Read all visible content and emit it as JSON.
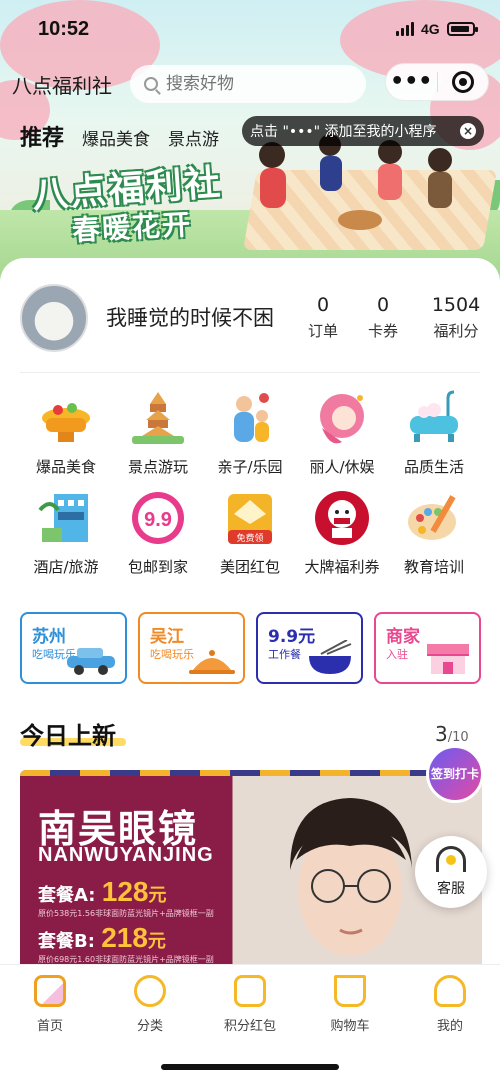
{
  "status_bar": {
    "time": "10:52",
    "network": "4G"
  },
  "nav": {
    "title": "八点福利社",
    "search_placeholder": "搜索好物",
    "more_label": "•••"
  },
  "tabs": [
    {
      "label": "推荐",
      "active": true
    },
    {
      "label": "爆品美食"
    },
    {
      "label": "景点游"
    }
  ],
  "tip": {
    "text": "点击 \"•••\" 添加至我的小程序",
    "close": "×"
  },
  "banner": {
    "title": "八点福利社",
    "subtitle": "春暖花开"
  },
  "profile": {
    "username": "我睡觉的时候不困",
    "stats": [
      {
        "value": "0",
        "label": "订单"
      },
      {
        "value": "0",
        "label": "卡券"
      },
      {
        "value": "1504",
        "label": "福利分"
      }
    ]
  },
  "categories": [
    {
      "label": "爆品美食",
      "icon": "hotpot-icon",
      "color": "#f6b627"
    },
    {
      "label": "景点游玩",
      "icon": "pagoda-icon",
      "color": "#e6a34a"
    },
    {
      "label": "亲子/乐园",
      "icon": "family-icon",
      "color": "#5aa9e6"
    },
    {
      "label": "丽人/休娱",
      "icon": "beauty-icon",
      "color": "#f07aa0"
    },
    {
      "label": "品质生活",
      "icon": "bathtub-icon",
      "color": "#4cc2e0"
    },
    {
      "label": "酒店/旅游",
      "icon": "hotel-icon",
      "color": "#52b5e8"
    },
    {
      "label": "包邮到家",
      "icon": "nine-nine-icon",
      "color": "#e93b8c",
      "text": "9.9"
    },
    {
      "label": "美团红包",
      "icon": "red-packet-icon",
      "color": "#f4b428",
      "text": "免费领"
    },
    {
      "label": "大牌福利券",
      "icon": "kfc-icon",
      "color": "#c8102e"
    },
    {
      "label": "教育培训",
      "icon": "palette-icon",
      "color": "#f28b3c"
    }
  ],
  "promos": [
    {
      "title": "苏州",
      "subtitle": "吃喝玩乐",
      "color": "#2f8fd8",
      "icon": "car-icon"
    },
    {
      "title": "吴江",
      "subtitle": "吃喝玩乐",
      "color": "#f08a24",
      "icon": "dish-cover-icon"
    },
    {
      "title": "9.9元",
      "subtitle": "工作餐",
      "color": "#2b2fae",
      "icon": "noodle-bowl-icon"
    },
    {
      "title": "商家",
      "subtitle": "入驻",
      "color": "#e8488f",
      "icon": "shop-icon"
    }
  ],
  "section": {
    "title": "今日上新",
    "page_current": "3",
    "page_sep": "/",
    "page_total": "10"
  },
  "product": {
    "name": "南吴眼镜",
    "pinyin": "NANWUYANJING",
    "packages": [
      {
        "label": "套餐A:",
        "price": "128",
        "unit": "元",
        "note": "原价538元1.56非球面防蓝光镜片+品牌镜框一副"
      },
      {
        "label": "套餐B:",
        "price": "218",
        "unit": "元",
        "note": "原价698元1.60非球面防蓝光镜片+品牌镜框一副"
      }
    ]
  },
  "checkin": {
    "label": "签到打卡"
  },
  "service": {
    "label": "客服"
  },
  "tabbar": [
    {
      "label": "首页",
      "icon": "home-icon"
    },
    {
      "label": "分类",
      "icon": "category-icon"
    },
    {
      "label": "积分红包",
      "icon": "points-icon"
    },
    {
      "label": "购物车",
      "icon": "cart-icon"
    },
    {
      "label": "我的",
      "icon": "profile-icon"
    }
  ],
  "colors": {
    "accent": "#f5b826",
    "brand_green": "#2e8b4f",
    "product_bg": "#8a1d47",
    "price": "#ffc23a"
  }
}
